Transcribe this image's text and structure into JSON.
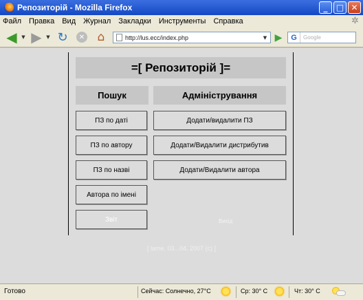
{
  "window": {
    "title": "Репозиторій - Mozilla Firefox"
  },
  "menu": [
    "Файл",
    "Правка",
    "Вид",
    "Журнал",
    "Закладки",
    "Инструменты",
    "Справка"
  ],
  "nav": {
    "url": "http://lus.ecc/index.php",
    "search_placeholder": "Google",
    "search_engine": "G"
  },
  "page": {
    "header": "=[ Репозиторій ]=",
    "search_title": "Пошук",
    "admin_title": "Адміністрування",
    "search_buttons": [
      "ПЗ по даті",
      "ПЗ по автору",
      "ПЗ по назві",
      "Автора по імені",
      "Звіт"
    ],
    "admin_buttons": [
      "Додати/видалити ПЗ",
      "Додати/Видалити дистрибутив",
      "Додати/Видалити автора"
    ],
    "exit_label": "Вихід",
    "footer": "[ lame. 03...04. 2007 (c) ]"
  },
  "status": {
    "text": "Готово",
    "weather_now": "Сейчас: Солнечно, 27°C",
    "weather_wed": "Ср: 30° C",
    "weather_thu": "Чт: 30° C"
  },
  "colors": {
    "titlebar": "#1448c4",
    "chrome": "#ece9d8",
    "content_bg": "#dcdcdc",
    "header_bg": "#c6c6c6"
  }
}
